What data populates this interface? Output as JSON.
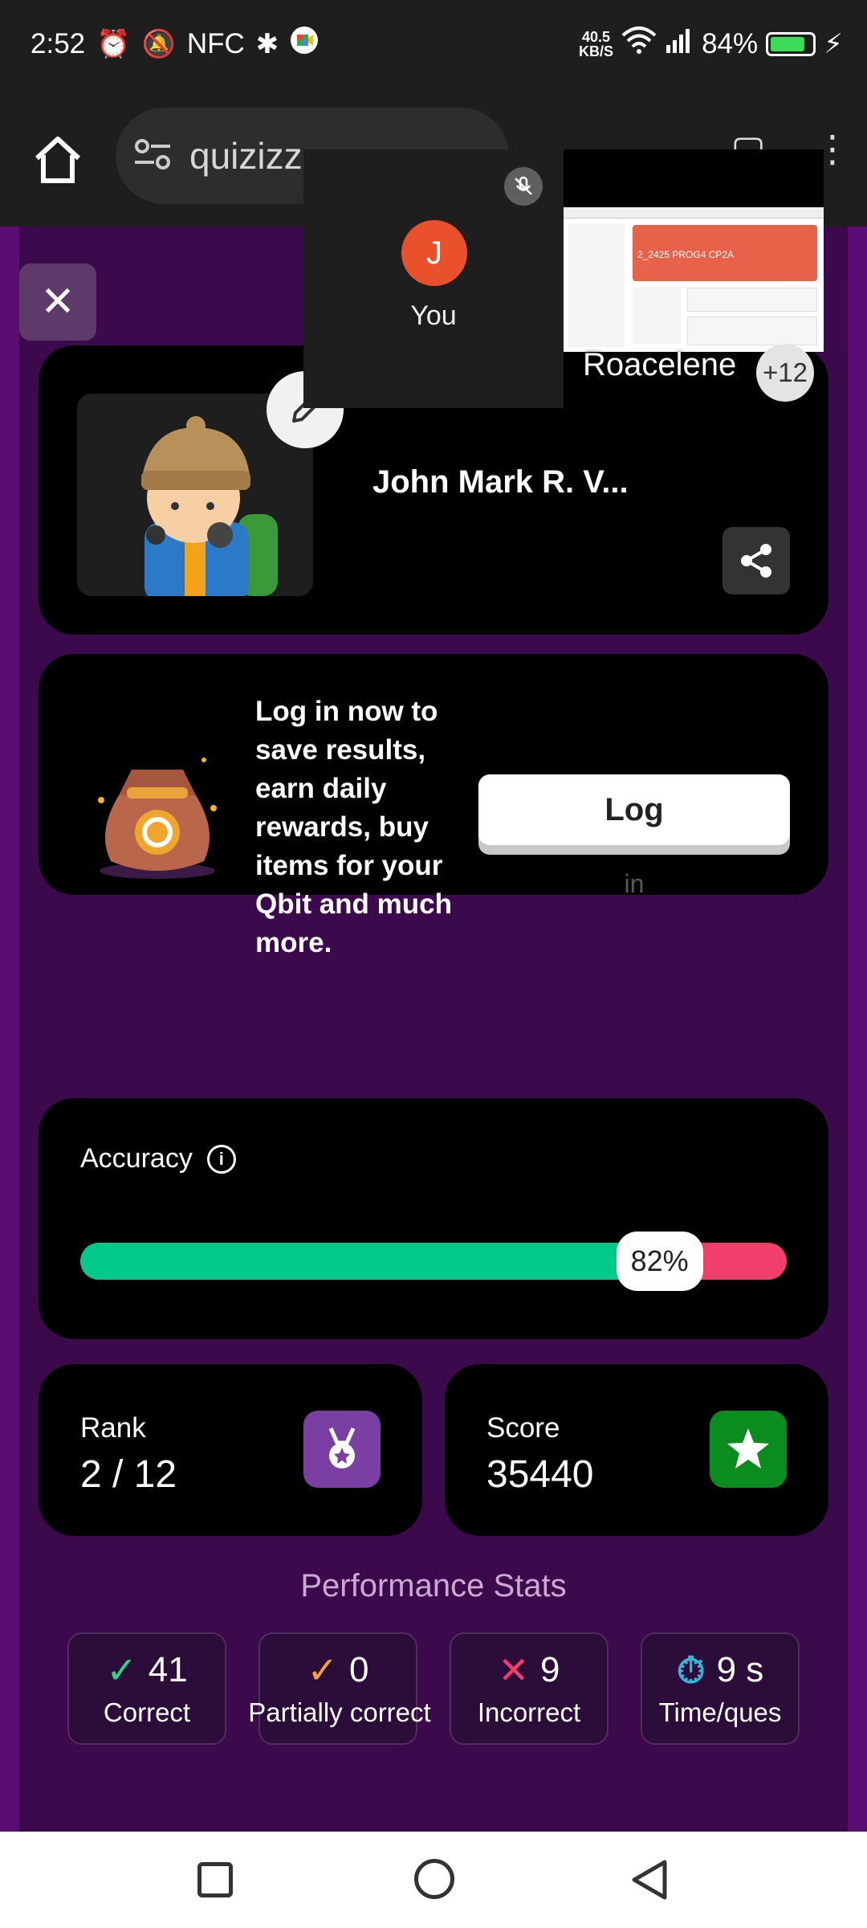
{
  "status_bar": {
    "time": "2:52",
    "nfc": "NFC",
    "speed_value": "40.5",
    "speed_unit": "KB/S",
    "battery": "84%",
    "battery_level": 0.84
  },
  "browser": {
    "url": "quizizz"
  },
  "call": {
    "avatar_letter": "J",
    "self_label": "You",
    "presenter_name": "Roacelene",
    "extra_participants": "+12",
    "thumb_title": "2_2425 PROG4 CP2A"
  },
  "profile": {
    "player_name": "John Mark R. V..."
  },
  "login_promo": {
    "message": "Log in now to save results, earn daily rewards, buy items for your Qbit and much more.",
    "button_label": "Log",
    "button_label_overflow": "in"
  },
  "accuracy": {
    "label": "Accuracy",
    "value": 82,
    "display": "82%",
    "colors": {
      "correct": "#00c98a",
      "incorrect": "#ef3f6a"
    }
  },
  "rank": {
    "label": "Rank",
    "value": "2 / 12",
    "icon": "medal-icon",
    "color": "#7b3ea3"
  },
  "score": {
    "label": "Score",
    "value": "35440",
    "icon": "star-icon",
    "color": "#0b8c1e"
  },
  "performance": {
    "title": "Performance Stats",
    "stats": [
      {
        "mark": "✓",
        "value": "41",
        "label": "Correct",
        "color": "#2fd38a"
      },
      {
        "mark": "✓",
        "value": "0",
        "label": "Partially correct",
        "color": "#f2a23a"
      },
      {
        "mark": "✕",
        "value": "9",
        "label": "Incorrect",
        "color": "#ef3f6a"
      },
      {
        "mark": "⏱",
        "value": "9 s",
        "label": "Time/ques",
        "color": "#36b5d6"
      }
    ]
  }
}
